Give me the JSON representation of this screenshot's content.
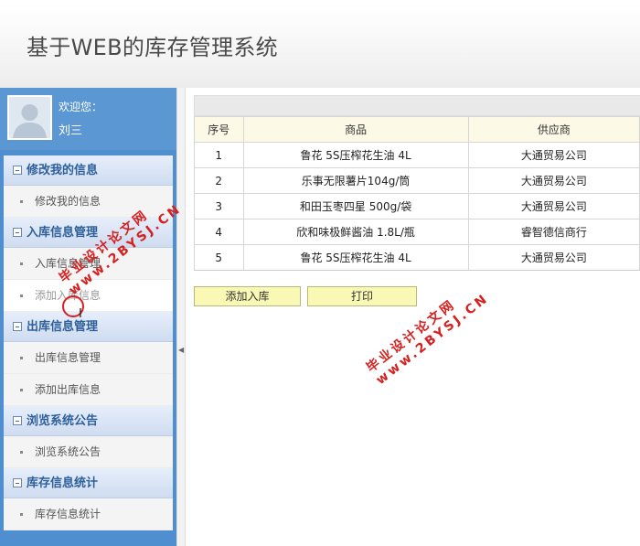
{
  "header": {
    "title": "基于WEB的库存管理系统"
  },
  "user": {
    "welcome": "欢迎您：",
    "name": "刘三"
  },
  "menu": [
    {
      "title": "修改我的信息",
      "items": [
        "修改我的信息"
      ]
    },
    {
      "title": "入库信息管理",
      "items": [
        "入库信息管理",
        "添加入库信息"
      ]
    },
    {
      "title": "出库信息管理",
      "items": [
        "出库信息管理",
        "添加出库信息"
      ]
    },
    {
      "title": "浏览系统公告",
      "items": [
        "浏览系统公告"
      ]
    },
    {
      "title": "库存信息统计",
      "items": [
        "库存信息统计"
      ]
    }
  ],
  "table": {
    "columns": [
      "序号",
      "商品",
      "供应商"
    ],
    "rows": [
      [
        "1",
        "鲁花 5S压榨花生油 4L",
        "大通贸易公司"
      ],
      [
        "2",
        "乐事无限薯片104g/筒",
        "大通贸易公司"
      ],
      [
        "3",
        "和田玉枣四星 500g/袋",
        "大通贸易公司"
      ],
      [
        "4",
        "欣和味极鲜酱油 1.8L/瓶",
        "睿智德信商行"
      ],
      [
        "5",
        "鲁花 5S压榨花生油 4L",
        "大通贸易公司"
      ]
    ]
  },
  "buttons": {
    "add": "添加入库",
    "print": "打印"
  },
  "watermark": {
    "line1": "毕业设计论文网",
    "line2": "www.2BYSJ.CN"
  }
}
